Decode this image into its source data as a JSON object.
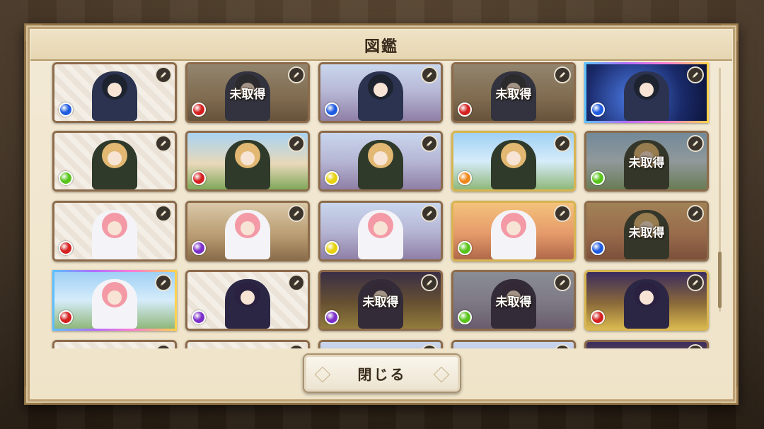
{
  "dialog": {
    "title": "図鑑",
    "close_label": "閉じる",
    "locked_label": "未取得"
  },
  "colors": {
    "frame": "#8a6d45",
    "panel": "#f3ead6",
    "orb_blue": "#1f5be0",
    "orb_red": "#d52020",
    "orb_green": "#58c41a",
    "orb_yellow": "#e8d20e",
    "orb_orange": "#f0871a",
    "orb_purple": "#7b2ec8"
  },
  "cards": [
    {
      "row": 0,
      "col": 0,
      "locked": false,
      "orb": "blue",
      "bg": "plain",
      "char": "dark",
      "frame": "normal"
    },
    {
      "row": 0,
      "col": 1,
      "locked": true,
      "orb": "red",
      "bg": "castle",
      "char": "dark",
      "frame": "normal"
    },
    {
      "row": 0,
      "col": 2,
      "locked": false,
      "orb": "blue",
      "bg": "town",
      "char": "dark",
      "frame": "normal"
    },
    {
      "row": 0,
      "col": 3,
      "locked": true,
      "orb": "red",
      "bg": "castle",
      "char": "dark",
      "frame": "normal"
    },
    {
      "row": 0,
      "col": 4,
      "locked": false,
      "orb": "blue",
      "bg": "night",
      "char": "dark",
      "frame": "rainbow"
    },
    {
      "row": 1,
      "col": 0,
      "locked": false,
      "orb": "green",
      "bg": "plain",
      "char": "blonde",
      "frame": "normal"
    },
    {
      "row": 1,
      "col": 1,
      "locked": false,
      "orb": "red",
      "bg": "house",
      "char": "blonde",
      "frame": "normal"
    },
    {
      "row": 1,
      "col": 2,
      "locked": false,
      "orb": "yellow",
      "bg": "town",
      "char": "blonde",
      "frame": "normal"
    },
    {
      "row": 1,
      "col": 3,
      "locked": false,
      "orb": "orange",
      "bg": "sky",
      "char": "blonde",
      "frame": "gold"
    },
    {
      "row": 1,
      "col": 4,
      "locked": true,
      "orb": "green",
      "bg": "sky",
      "char": "blonde",
      "frame": "normal"
    },
    {
      "row": 2,
      "col": 0,
      "locked": false,
      "orb": "red",
      "bg": "plain",
      "char": "pink",
      "frame": "normal"
    },
    {
      "row": 2,
      "col": 1,
      "locked": false,
      "orb": "purple",
      "bg": "castle",
      "char": "pink",
      "frame": "normal"
    },
    {
      "row": 2,
      "col": 2,
      "locked": false,
      "orb": "yellow",
      "bg": "town",
      "char": "pink",
      "frame": "normal"
    },
    {
      "row": 2,
      "col": 3,
      "locked": false,
      "orb": "green",
      "bg": "sunset",
      "char": "pink",
      "frame": "gold"
    },
    {
      "row": 2,
      "col": 4,
      "locked": true,
      "orb": "blue",
      "bg": "sunset",
      "char": "blonde",
      "frame": "normal"
    },
    {
      "row": 3,
      "col": 0,
      "locked": false,
      "orb": "red",
      "bg": "sky",
      "char": "pink",
      "frame": "rainbow"
    },
    {
      "row": 3,
      "col": 1,
      "locked": false,
      "orb": "purple",
      "bg": "plain",
      "char": "purple",
      "frame": "normal"
    },
    {
      "row": 3,
      "col": 2,
      "locked": true,
      "orb": "purple",
      "bg": "palace",
      "char": "purple",
      "frame": "normal"
    },
    {
      "row": 3,
      "col": 3,
      "locked": true,
      "orb": "green",
      "bg": "town",
      "char": "purple",
      "frame": "normal"
    },
    {
      "row": 3,
      "col": 4,
      "locked": false,
      "orb": "red",
      "bg": "palace",
      "char": "purple",
      "frame": "gold"
    },
    {
      "row": 4,
      "col": 0,
      "locked": false,
      "orb": "red",
      "bg": "plain",
      "char": "dark",
      "frame": "normal"
    },
    {
      "row": 4,
      "col": 1,
      "locked": false,
      "orb": "red",
      "bg": "plain",
      "char": "dark",
      "frame": "normal"
    },
    {
      "row": 4,
      "col": 2,
      "locked": false,
      "orb": "red",
      "bg": "town",
      "char": "dark",
      "frame": "normal"
    },
    {
      "row": 4,
      "col": 3,
      "locked": false,
      "orb": "red",
      "bg": "town",
      "char": "dark",
      "frame": "normal"
    },
    {
      "row": 4,
      "col": 4,
      "locked": false,
      "orb": "red",
      "bg": "palace",
      "char": "dark",
      "frame": "normal"
    }
  ]
}
